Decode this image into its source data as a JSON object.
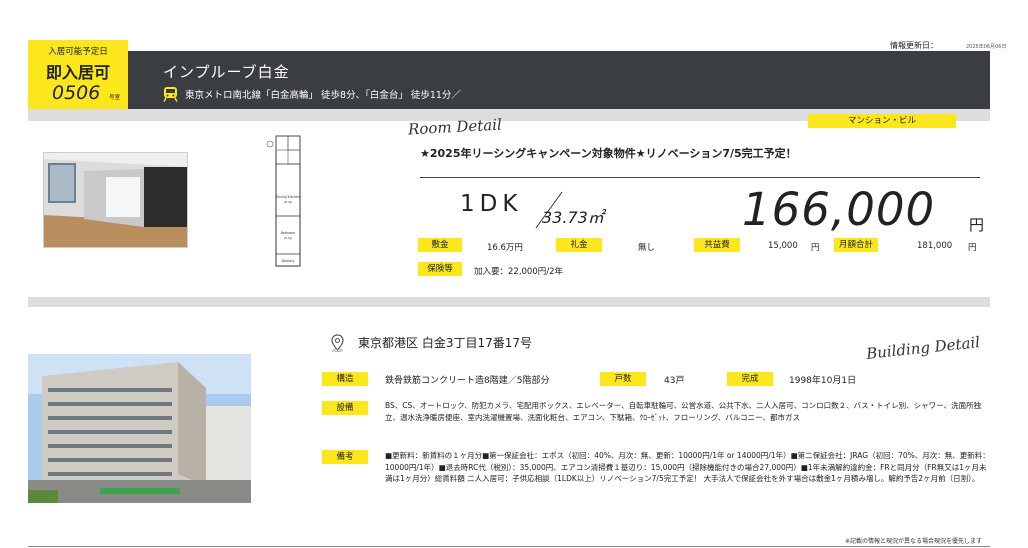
{
  "update": {
    "label": "情報更新日：",
    "date": "2025年06月06日"
  },
  "badge": {
    "label": "入居可能予定日",
    "status": "即入居可",
    "room_number": "0506",
    "room_suffix": "号室"
  },
  "header": {
    "title": "インプルーブ白金",
    "access": "東京メトロ南北線「白金高輪」 徒歩8分、「白金台」 徒歩11分／"
  },
  "room": {
    "section_title": "Room Detail",
    "building_type": "マンション・ビル",
    "campaign": "★2025年リーシングキャンペーン対象物件★リノベーション7/5完工予定！",
    "layout": "1DK",
    "area": "33.73㎡",
    "rent": "166,000",
    "rent_unit": "円",
    "deposit_label": "敷金",
    "deposit_value": "16.6万円",
    "key_money_label": "礼金",
    "key_money_value": "無し",
    "mgmt_label": "共益費",
    "mgmt_value": "15,000",
    "mgmt_unit": "円",
    "monthly_total_label": "月額合計",
    "monthly_total_value": "181,000",
    "monthly_total_unit": "円",
    "insurance_label": "保険等",
    "insurance_value": "加入要：22,000円/2年",
    "floorplan_labels": {
      "kitchen": "Dining Kitchen",
      "kitchen_size": "(8.4J)",
      "bedroom": "Bedroom",
      "bedroom_size": "(6.0J)",
      "balcony": "Balcony"
    }
  },
  "building": {
    "section_title": "Building Detail",
    "address": "東京都港区 白金3丁目17番17号",
    "structure_label": "構造",
    "structure_value": "鉄骨鉄筋コンクリート造8階建／5階部分",
    "units_label": "戸数",
    "units_value": "43戸",
    "completion_label": "完成",
    "completion_value": "1998年10月1日",
    "facilities_label": "設備",
    "facilities_value": "BS、CS、オートロック、防犯カメラ、宅配用ボックス、エレベーター、自転車駐輪可、公営水道、公共下水、二人入居可、コンロ口数２、バス・トイレ別、シャワー、洗面所独立、温水洗浄暖房便座、室内洗濯機置場、洗面化粧台、エアコン、下駄箱、ｸﾛｰｾﾞｯﾄ、フローリング、バルコニー、都市ガス",
    "remarks_label": "備考",
    "remarks_value": "■更新料：新賃料の１ヶ月分■第一保証会社：エポス（初回：40%、月次：無、更新：10000円/1年 or 14000円/1年）■第二保証会社：JRAG（初回：70%、月次：無、更新料：10000円/1年）■退去時RC代（税別）：35,000円、エアコン清掃費１基辺り：15,000円（掃除機能付きの場合27,000円）■1年未満解約違約金：FRと同月分（FR無又は1ヶ月未満は1ヶ月分）総賃料額 二人入居可：子供応相談（1LDK以上）リノベーション7/5完工予定！ 大手法人で保証会社を外す場合は敷金1ヶ月積み増し。解約予告2ヶ月前（日割）。"
  },
  "footer": {
    "note": "※記載の情報と現況が異なる場合現況を優先します"
  },
  "colors": {
    "accent": "#fbe71c",
    "header_bg": "#3a3e43",
    "panel_bg": "#dddddd"
  },
  "icons": {
    "train": "train-icon",
    "pin": "map-pin-icon"
  }
}
